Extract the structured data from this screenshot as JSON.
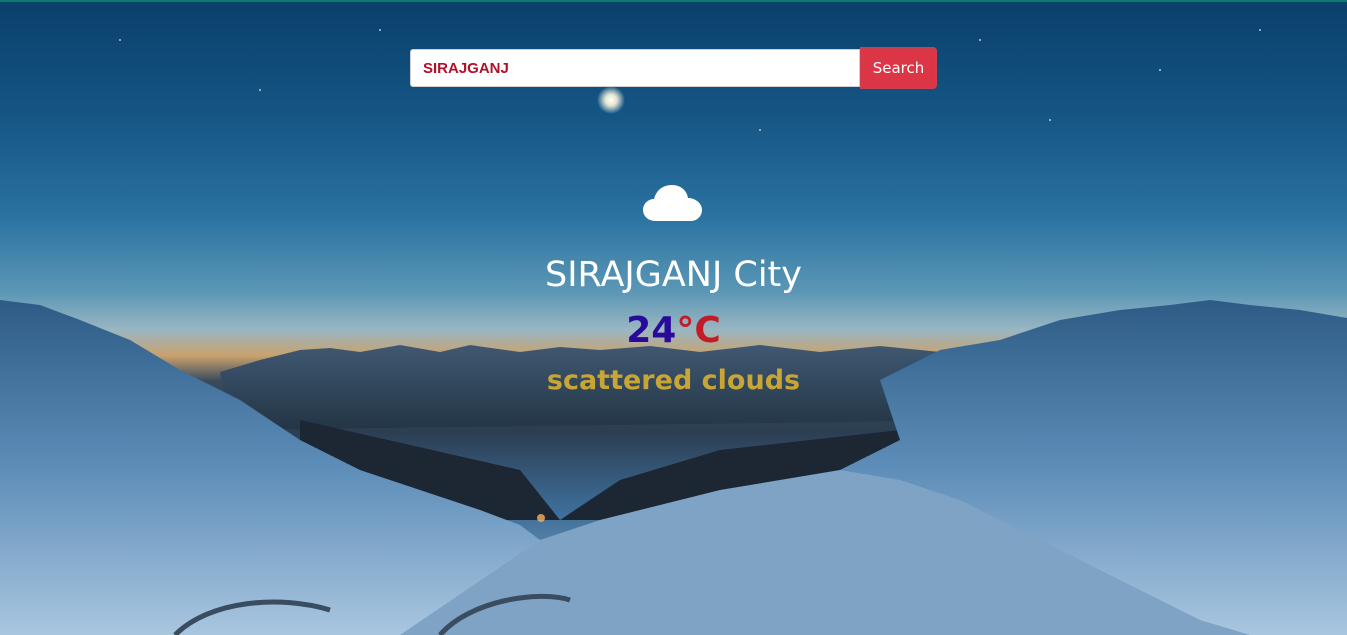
{
  "search": {
    "value": "SIRAJGANJ",
    "button_label": "Search"
  },
  "weather": {
    "icon": "cloud-icon",
    "city": "SIRAJGANJ City",
    "temperature": "24",
    "unit": "°C",
    "description": "scattered clouds"
  },
  "colors": {
    "button": "#dc3545",
    "input_text": "#b0102a",
    "temperature_value": "#2a0a9a",
    "temperature_unit": "#c21d26",
    "description": "#c9a535",
    "city": "#ffffff"
  },
  "background": "mountain-night-landscape"
}
